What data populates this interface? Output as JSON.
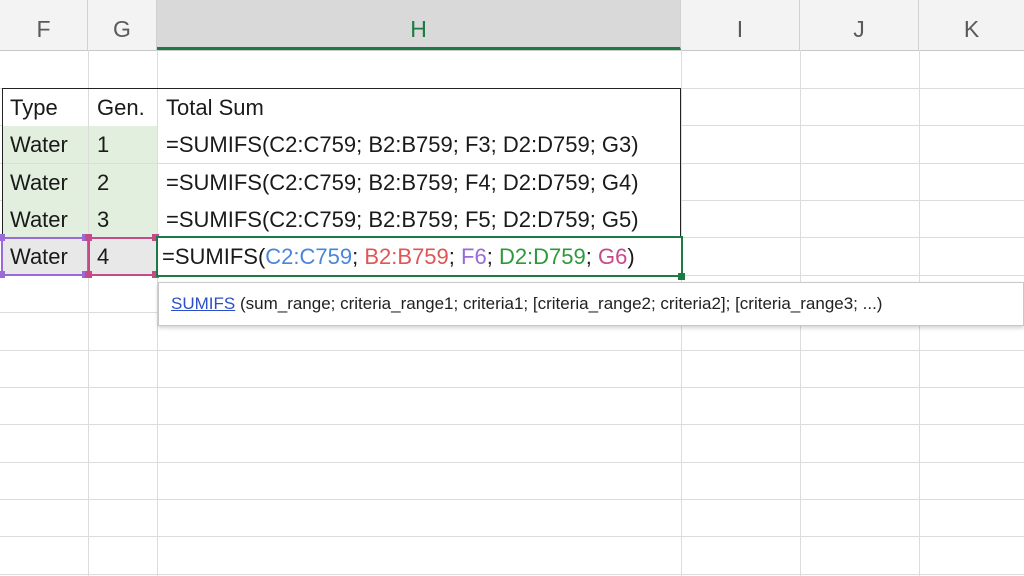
{
  "columns": [
    {
      "letter": "F"
    },
    {
      "letter": "G"
    },
    {
      "letter": "H"
    },
    {
      "letter": "I"
    },
    {
      "letter": "J"
    },
    {
      "letter": "K"
    }
  ],
  "active_column": "H",
  "table": {
    "headers": {
      "type": "Type",
      "gen": "Gen.",
      "total": "Total Sum"
    },
    "rows": [
      {
        "type": "Water",
        "gen": "1",
        "formula": "=SUMIFS(C2:C759; B2:B759; F3; D2:D759; G3)"
      },
      {
        "type": "Water",
        "gen": "2",
        "formula": "=SUMIFS(C2:C759; B2:B759; F4; D2:D759; G4)"
      },
      {
        "type": "Water",
        "gen": "3",
        "formula": "=SUMIFS(C2:C759; B2:B759; F5; D2:D759; G5)"
      },
      {
        "type": "Water",
        "gen": "4"
      }
    ]
  },
  "editing_formula": {
    "prefix": "=SUMIFS(",
    "ref1": "C2:C759",
    "sep1": "; ",
    "ref2": "B2:B759",
    "sep2": "; ",
    "ref3": "F6",
    "sep3": "; ",
    "ref4": "D2:D759",
    "sep4": "; ",
    "ref5": "G6",
    "suffix": ")",
    "ref_colors": {
      "ref1": "#4a86d8",
      "ref2": "#e05555",
      "ref3": "#9a6ad6",
      "ref4": "#2d9a3a",
      "ref5": "#c44a8a"
    }
  },
  "tooltip": {
    "function_name": "SUMIFS",
    "signature": " (sum_range; criteria_range1; criteria1; [criteria_range2; criteria2]; [criteria_range3; ...)"
  },
  "colors": {
    "accent_green": "#1e7a45",
    "header_bg": "#f3f3f3",
    "data_fill": "#e3efde"
  }
}
